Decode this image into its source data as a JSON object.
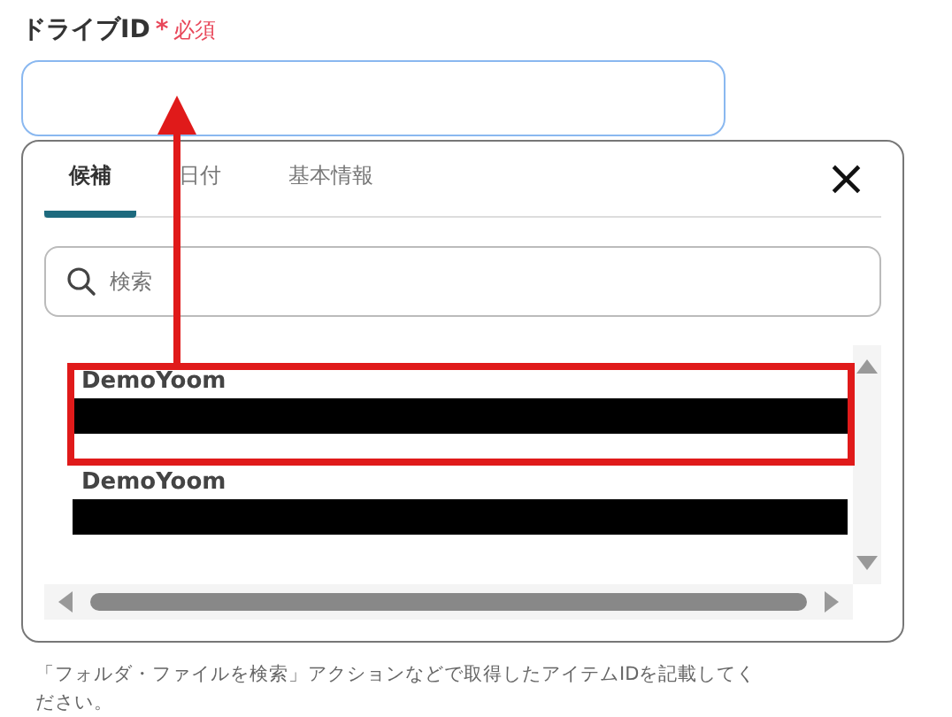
{
  "field": {
    "label": "ドライブID",
    "required_mark": "*",
    "required_text": "必須"
  },
  "popup": {
    "tabs": [
      {
        "label": "候補",
        "selected": true
      },
      {
        "label": "日付",
        "selected": false
      },
      {
        "label": "基本情報",
        "selected": false
      }
    ],
    "close": "×",
    "search": {
      "placeholder": "検索"
    },
    "items": [
      {
        "title": "DemoYoom"
      },
      {
        "title": "DemoYoom"
      }
    ]
  },
  "help_text": "「フォルダ・ファイルを検索」アクションなどで取得したアイテムIDを記載してください。"
}
